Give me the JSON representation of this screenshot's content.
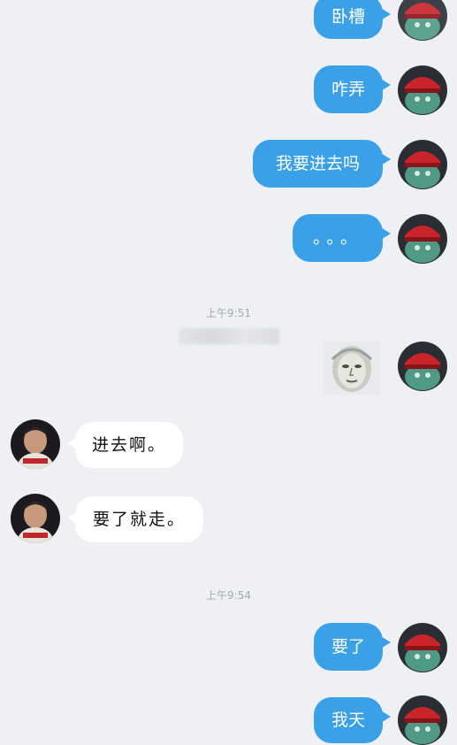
{
  "messages": [
    {
      "side": "out",
      "text": "卧槽"
    },
    {
      "side": "out",
      "text": "咋弄"
    },
    {
      "side": "out",
      "text": "我要进去吗"
    },
    {
      "side": "out",
      "text": "。。。"
    },
    {
      "side": "out",
      "type": "sticker",
      "sticker": "face-sticker"
    },
    {
      "side": "in",
      "text": "进去啊。"
    },
    {
      "side": "in",
      "text": "要了就走。"
    },
    {
      "side": "out",
      "text": "要了"
    },
    {
      "side": "out",
      "text": "我天"
    }
  ],
  "timestamps": [
    "上午9:51",
    "上午9:54"
  ],
  "colors": {
    "background": "#eef0f4",
    "outgoing_bubble": "#3aa0e8",
    "incoming_bubble": "#ffffff",
    "timestamp_text": "#a6a9ae"
  },
  "avatars": {
    "self": "red-cap-creature-avatar",
    "other": "man-in-red-shirt-avatar"
  }
}
